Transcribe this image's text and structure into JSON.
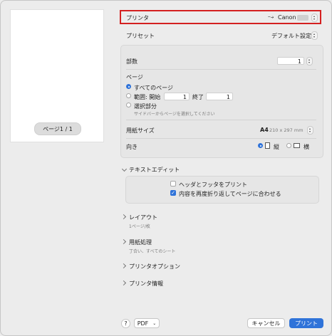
{
  "preview": {
    "page_label": "ページ1 / 1"
  },
  "printer": {
    "label": "プリンタ",
    "value": "Canon",
    "highlight_color": "#d42020"
  },
  "preset": {
    "label": "プリセット",
    "value": "デフォルト設定"
  },
  "copies": {
    "label": "部数",
    "value": "1"
  },
  "pages": {
    "label": "ページ",
    "all": "すべてのページ",
    "range": "範囲: 開始",
    "range_from": "1",
    "range_to_label": "終了",
    "range_to": "1",
    "selection": "選択部分",
    "selection_hint": "サイドバーからページを選択してください"
  },
  "paper_size": {
    "label": "用紙サイズ",
    "value": "A4",
    "dims": "210 x 297 mm"
  },
  "orientation": {
    "label": "向き",
    "portrait": "縦",
    "landscape": "横"
  },
  "text_edit": {
    "title": "テキストエディット",
    "headers": "ヘッダとフッタをプリント",
    "rewrap": "内容を再度折り返してページに合わせる"
  },
  "layout": {
    "title": "レイアウト",
    "summary": "1ページ/枚"
  },
  "paper_handling": {
    "title": "用紙処理",
    "summary": "丁合い、すべてのシート"
  },
  "printer_options": {
    "title": "プリンタオプション"
  },
  "printer_info": {
    "title": "プリンタ情報"
  },
  "footer": {
    "help": "?",
    "pdf": "PDF",
    "cancel": "キャンセル",
    "print": "プリント"
  },
  "colors": {
    "accent": "#2f73d9"
  }
}
